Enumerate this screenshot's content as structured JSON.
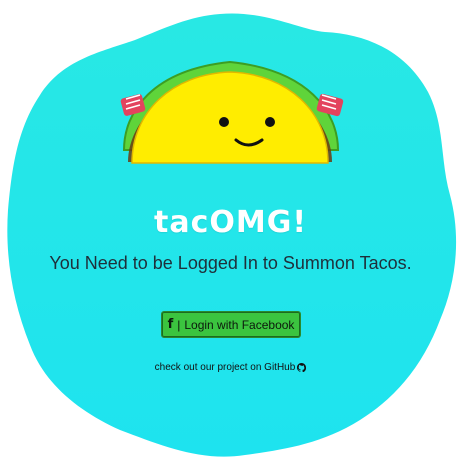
{
  "app": {
    "title": "tacOMG!",
    "message": "You Need to be Logged In to Summon Tacos."
  },
  "login": {
    "icon": "facebook-f-icon",
    "separator": "|",
    "label": "Login with Facebook"
  },
  "footer": {
    "text": "check out our project on GitHub",
    "icon": "github-icon"
  },
  "colors": {
    "background_top": "#28e8e4",
    "background_bottom": "#1ee3ef",
    "button": "#3bc43f",
    "taco_shell": "#ffed00",
    "lettuce": "#5fd43a",
    "tomato": "#e3435e"
  }
}
